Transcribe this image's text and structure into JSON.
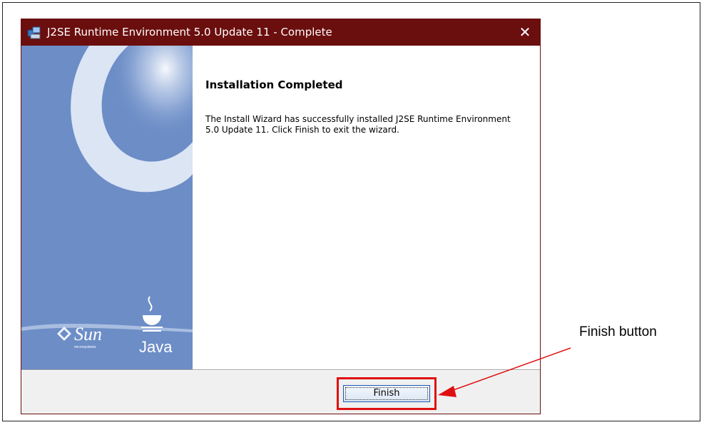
{
  "window": {
    "title": "J2SE Runtime Environment 5.0 Update 11 - Complete",
    "close_glyph": "✕"
  },
  "wizard": {
    "heading": "Installation Completed",
    "message": "The Install Wizard has successfully installed J2SE Runtime Environment 5.0 Update 11. Click Finish to exit the wizard."
  },
  "sidebar": {
    "sun_logo": "Sun",
    "sun_sub": "microsystems",
    "java_logo": "Java"
  },
  "footer": {
    "finish_label": "Finish"
  },
  "annotation": {
    "callout_text": "Finish button",
    "highlight_color": "#e01010"
  },
  "colors": {
    "titlebar": "#6b0e0e",
    "sidebar": "#6c8dc6"
  }
}
